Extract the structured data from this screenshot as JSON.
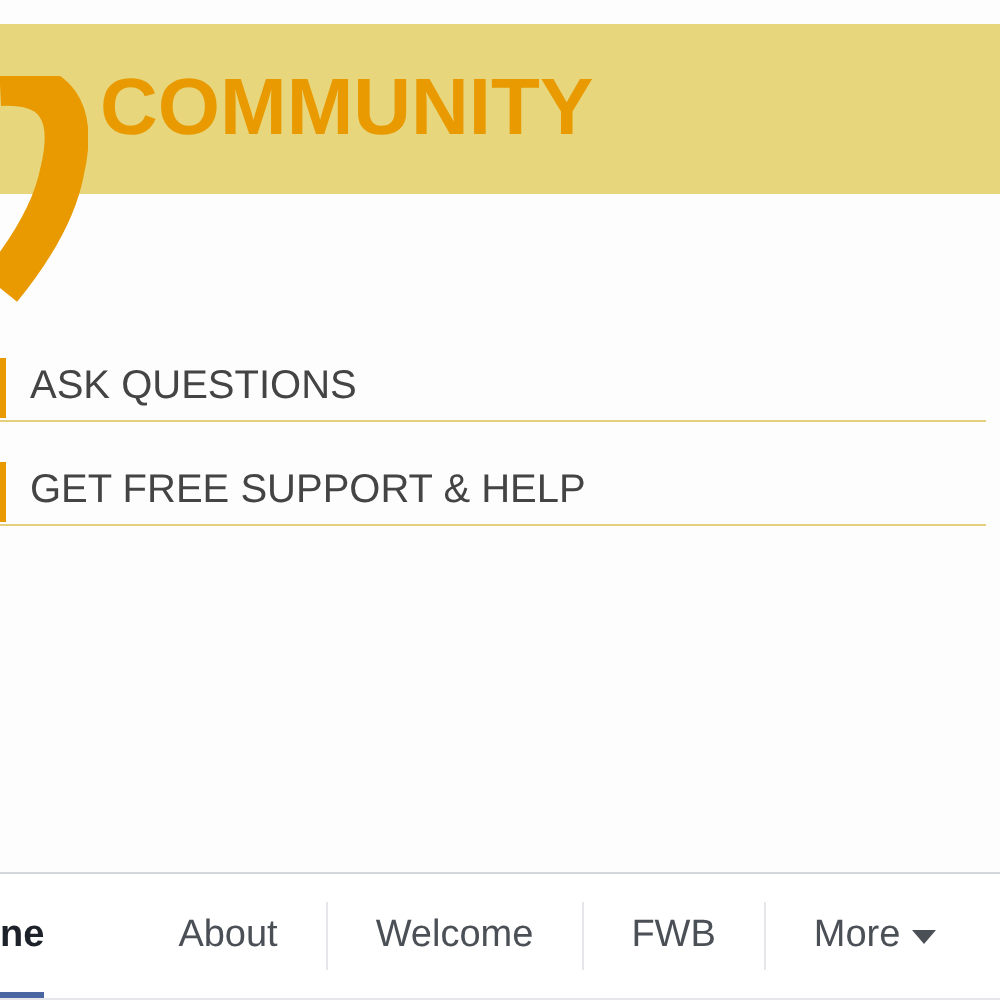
{
  "banner": {
    "title": "COMMUNITY"
  },
  "links": [
    {
      "label": "ASK QUESTIONS"
    },
    {
      "label": "GET FREE SUPPORT & HELP"
    }
  ],
  "tabs": [
    {
      "label": "ne",
      "selected": true
    },
    {
      "label": "About",
      "selected": false
    },
    {
      "label": "Welcome",
      "selected": false
    },
    {
      "label": "FWB",
      "selected": false
    },
    {
      "label": "More",
      "selected": false,
      "kind": "menu"
    }
  ]
}
